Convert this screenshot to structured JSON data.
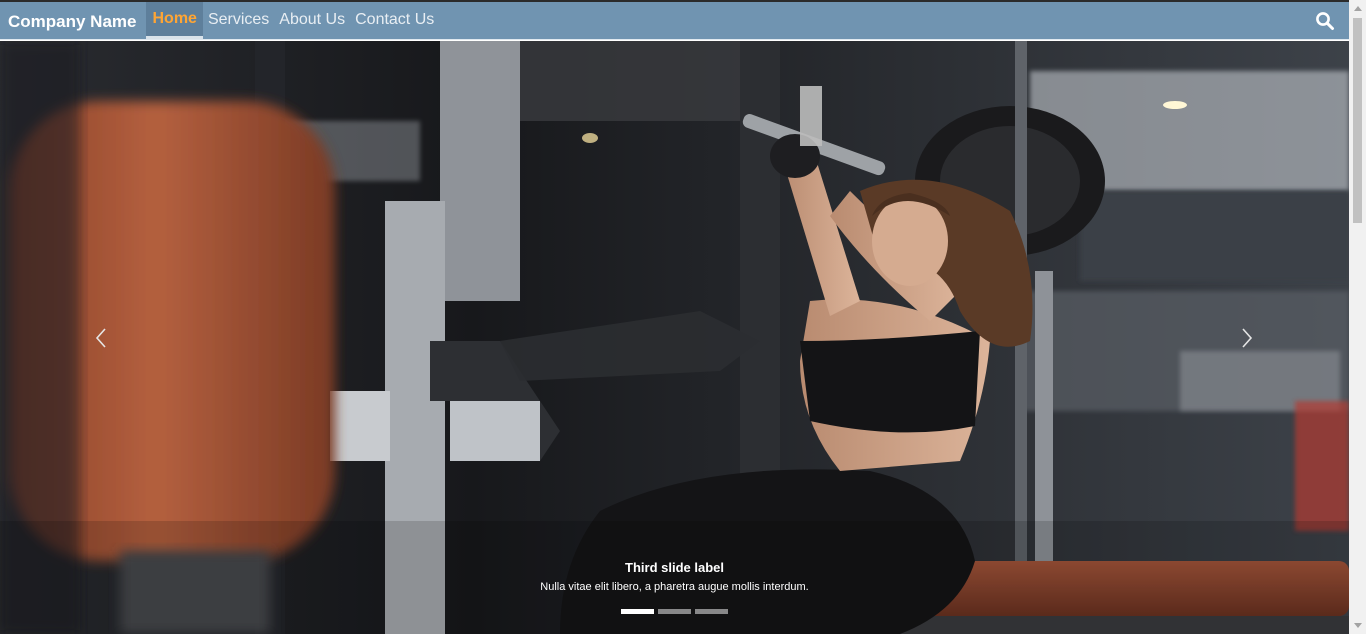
{
  "navbar": {
    "brand": "Company Name",
    "items": [
      {
        "label": "Home",
        "active": true
      },
      {
        "label": "Services",
        "active": false
      },
      {
        "label": "About Us",
        "active": false
      },
      {
        "label": "Contact Us",
        "active": false
      }
    ],
    "search_icon": "search-icon"
  },
  "carousel": {
    "caption_title": "Third slide label",
    "caption_text": "Nulla vitae elit libero, a pharetra augue mollis interdum.",
    "indicators": [
      {
        "active": true
      },
      {
        "active": false
      },
      {
        "active": false
      }
    ],
    "prev_icon": "chevron-left-icon",
    "next_icon": "chevron-right-icon"
  },
  "colors": {
    "navbar_bg": "#7094b1",
    "active_text": "#ffa534",
    "active_bg": "#5e7f9b"
  }
}
